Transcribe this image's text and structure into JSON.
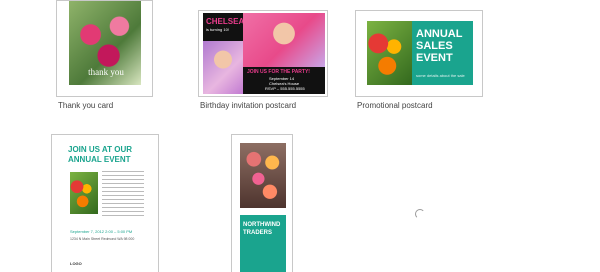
{
  "templates": [
    {
      "name": "Thank you card",
      "overlay_text": "thank you"
    },
    {
      "name": "Birthday invitation postcard",
      "headline": "CHELSEA",
      "subline": "is turning 10!",
      "cta": "JOIN US FOR THE PARTY!",
      "date": "September 14",
      "place": "Chelsea's House",
      "rsvp": "RSVP – 555.555.5555"
    },
    {
      "name": "Promotional postcard",
      "headline": "ANNUAL SALES EVENT",
      "fine": "some details about the sale"
    },
    {
      "name": "",
      "headline": "JOIN US AT OUR ANNUAL EVENT",
      "date_line": "September 7, 2012 2:00 – 5:00 PM",
      "address": "1234 N Main Street Redmond WA 98 000",
      "logo": "LOGO"
    },
    {
      "name": "",
      "headline": "NORTHWIND TRADERS"
    }
  ],
  "colors": {
    "teal": "#1aa48e",
    "pink": "#e83c8c",
    "black": "#111111"
  }
}
